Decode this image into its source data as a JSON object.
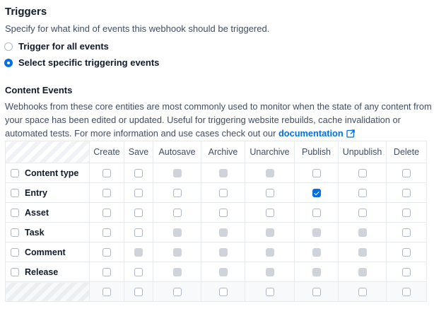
{
  "triggers": {
    "title": "Triggers",
    "subtitle": "Specify for what kind of events this webhook should be triggered.",
    "options": [
      {
        "label": "Trigger for all events",
        "selected": false
      },
      {
        "label": "Select specific triggering events",
        "selected": true
      }
    ]
  },
  "content_events": {
    "title": "Content Events",
    "description": "Webhooks from these core entities are most commonly used to monitor when the state of any content from your space has been edited or updated. Useful for triggering website rebuilds, cache invalidation or automated tests. For more information and use cases check out our ",
    "link_label": "documentation",
    "columns": [
      "Create",
      "Save",
      "Autosave",
      "Archive",
      "Unarchive",
      "Publish",
      "Unpublish",
      "Delete"
    ],
    "rows": [
      {
        "label": "Content type",
        "cells": [
          "empty",
          "empty",
          "disabled",
          "disabled",
          "disabled",
          "empty",
          "empty",
          "empty"
        ]
      },
      {
        "label": "Entry",
        "cells": [
          "empty",
          "empty",
          "empty",
          "empty",
          "empty",
          "checked",
          "empty",
          "empty"
        ]
      },
      {
        "label": "Asset",
        "cells": [
          "empty",
          "empty",
          "empty",
          "empty",
          "empty",
          "empty",
          "empty",
          "empty"
        ]
      },
      {
        "label": "Task",
        "cells": [
          "empty",
          "empty",
          "disabled",
          "disabled",
          "disabled",
          "disabled",
          "disabled",
          "empty"
        ]
      },
      {
        "label": "Comment",
        "cells": [
          "empty",
          "disabled",
          "disabled",
          "disabled",
          "disabled",
          "disabled",
          "disabled",
          "empty"
        ]
      },
      {
        "label": "Release",
        "cells": [
          "empty",
          "empty",
          "disabled",
          "disabled",
          "disabled",
          "disabled",
          "disabled",
          "empty"
        ]
      }
    ],
    "footer_cells": [
      "empty",
      "empty",
      "empty",
      "empty",
      "empty",
      "empty",
      "empty",
      "empty"
    ]
  },
  "colors": {
    "accent": "#036fe3",
    "disabled": "#cfd3da",
    "border": "#e7ebee"
  }
}
